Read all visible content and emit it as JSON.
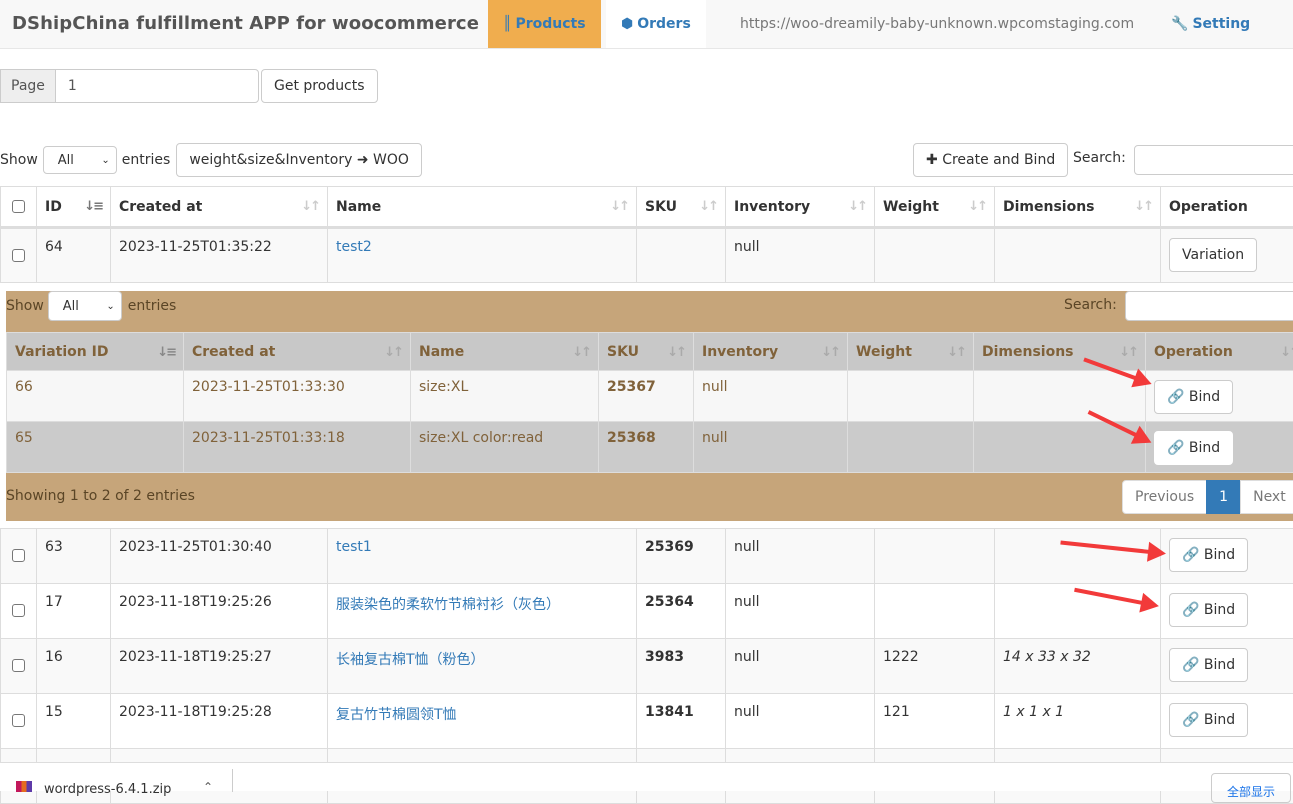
{
  "nav": {
    "brand": "DShipChina fulfillment APP for woocommerce",
    "tabs": [
      {
        "label": "Products",
        "icon": "barcode-icon",
        "active": true
      },
      {
        "label": "Orders",
        "icon": "cube-icon",
        "active": false
      }
    ],
    "site_url": "https://woo-dreamily-baby-unknown.wpcomstaging.com",
    "setting_label": "Setting"
  },
  "page_form": {
    "addon_label": "Page",
    "page_value": "1",
    "get_button": "Get products"
  },
  "controls": {
    "show_label": "Show",
    "entries_label": "entries",
    "length_selected": "All",
    "sync_button": "weight&size&Inventory",
    "sync_target": "WOO",
    "create_button": "Create and Bind",
    "search_label": "Search:",
    "search_value": ""
  },
  "main_table": {
    "columns": [
      "ID",
      "Created at",
      "Name",
      "SKU",
      "Inventory",
      "Weight",
      "Dimensions",
      "Operation"
    ],
    "rows": [
      {
        "id": "64",
        "created": "2023-11-25T01:35:22",
        "name": "test2",
        "sku": "",
        "inventory": "null",
        "weight": "",
        "dimensions": "",
        "operation": "Variation"
      },
      {
        "id": "63",
        "created": "2023-11-25T01:30:40",
        "name": "test1",
        "sku": "25369",
        "inventory": "null",
        "weight": "",
        "dimensions": "",
        "operation": "Bind"
      },
      {
        "id": "17",
        "created": "2023-11-18T19:25:26",
        "name": "服装染色的柔软竹节棉衬衫（灰色）",
        "sku": "25364",
        "inventory": "null",
        "weight": "",
        "dimensions": "",
        "operation": "Bind"
      },
      {
        "id": "16",
        "created": "2023-11-18T19:25:27",
        "name": "长袖复古棉T恤（粉色）",
        "sku": "3983",
        "inventory": "null",
        "weight": "1222",
        "dimensions": "14 x 33 x 32",
        "operation": "Bind"
      },
      {
        "id": "15",
        "created": "2023-11-18T19:25:28",
        "name": "复古竹节棉圆领T恤",
        "sku": "13841",
        "inventory": "null",
        "weight": "121",
        "dimensions": "1 x 1 x 1",
        "operation": "Bind"
      }
    ]
  },
  "variation_panel": {
    "show_label": "Show",
    "entries_label": "entries",
    "length_selected": "All",
    "search_label": "Search:",
    "columns": [
      "Variation ID",
      "Created at",
      "Name",
      "SKU",
      "Inventory",
      "Weight",
      "Dimensions",
      "Operation"
    ],
    "rows": [
      {
        "id": "66",
        "created": "2023-11-25T01:33:30",
        "name": "size:XL",
        "sku": "25367",
        "inventory": "null",
        "weight": "",
        "dimensions": "",
        "operation": "Bind"
      },
      {
        "id": "65",
        "created": "2023-11-25T01:33:18",
        "name": "size:XL color:read",
        "sku": "25368",
        "inventory": "null",
        "weight": "",
        "dimensions": "",
        "operation": "Bind"
      }
    ],
    "info": "Showing 1 to 2 of 2 entries",
    "pagination": {
      "previous": "Previous",
      "current": "1",
      "next": "Next"
    }
  },
  "download_bar": {
    "file_name": "wordpress-6.4.1.zip",
    "show_all": "全部显示"
  },
  "colors": {
    "accent": "#337ab7",
    "active_tab": "#f0ad4e",
    "panel_bg": "#c6a57a",
    "arrow": "#f23a3a"
  }
}
